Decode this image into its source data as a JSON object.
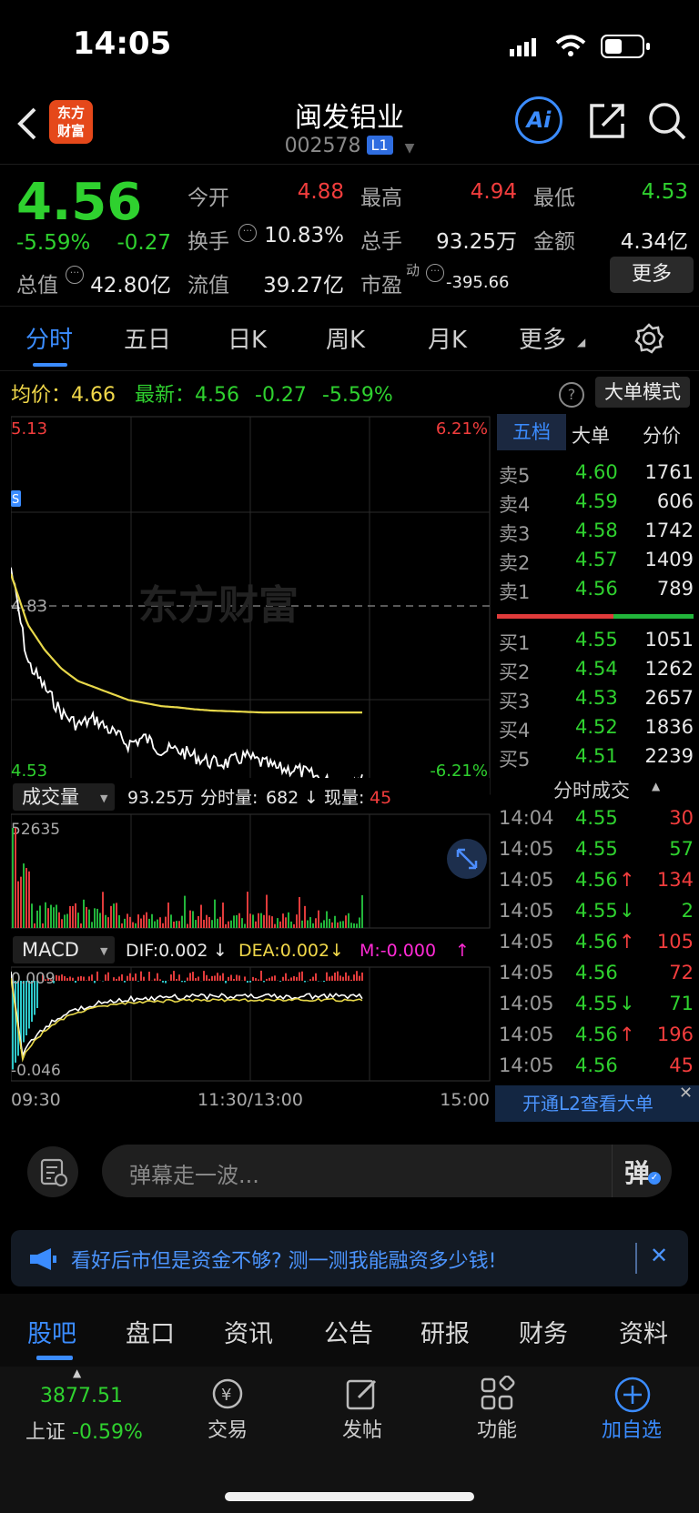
{
  "status_bar": {
    "time": "14:05"
  },
  "header": {
    "title": "闽发铝业",
    "code": "002578",
    "level_badge": "L1",
    "logo_line1": "东方",
    "logo_line2": "财富",
    "ai_label": "Ai"
  },
  "quote": {
    "price": "4.56",
    "change_pct": "-5.59%",
    "change": "-0.27",
    "open_label": "今开",
    "open": "4.88",
    "high_label": "最高",
    "high": "4.94",
    "low_label": "最低",
    "low": "4.53",
    "turnover_label": "换手",
    "turnover": "10.83%",
    "volume_label": "总手",
    "volume": "93.25万",
    "amount_label": "金额",
    "amount": "4.34亿",
    "total_cap_label": "总值",
    "total_cap": "42.80亿",
    "float_cap_label": "流值",
    "float_cap": "39.27亿",
    "pe_label": "市盈",
    "pe_sup": "动",
    "pe": "-395.66",
    "more_button": "更多"
  },
  "tabs": [
    "分时",
    "五日",
    "日K",
    "周K",
    "月K",
    "更多"
  ],
  "intraday": {
    "avg_label": "均价：",
    "avg": "4.66",
    "latest_label": "最新：",
    "latest": "4.56",
    "latest_change": "-0.27",
    "latest_pct": "-5.59%",
    "big_order_mode": "大单模式",
    "y_top": "5.13",
    "y_mid": "4.83",
    "y_bottom": "4.53",
    "pct_top": "6.21%",
    "pct_bottom": "-6.21%",
    "watermark": "东方财富",
    "volume_label": "成交量",
    "volume_total": "93.25万",
    "tick_vol_label": "分时量:",
    "tick_vol": "682",
    "cur_vol_label": "现量:",
    "cur_vol": "45",
    "vol_max": "52635",
    "macd_label": "MACD",
    "dif": "DIF:0.002",
    "dea": "DEA:0.002",
    "m": "M:-0.000",
    "macd_top": "0.009",
    "macd_bottom": "-0.046",
    "x_start": "09:30",
    "x_mid": "11:30/13:00",
    "x_end": "15:00",
    "s_badge": "S"
  },
  "chart_data": {
    "type": "line",
    "title": "",
    "xlabel": "",
    "ylabel": "",
    "ylim": [
      4.53,
      5.13
    ],
    "x_ticks": [
      "09:30",
      "11:30/13:00",
      "15:00"
    ],
    "prev_close": 4.83,
    "series": [
      {
        "name": "",
        "color": "#ffffff",
        "values": [
          4.89,
          4.74,
          4.7,
          4.66,
          4.64,
          4.65,
          4.63,
          4.61,
          4.62,
          4.6,
          4.6,
          4.59,
          4.58,
          4.58,
          4.59,
          4.58,
          4.57,
          4.57,
          4.56,
          4.55,
          4.55,
          4.56
        ]
      },
      {
        "name": "",
        "color": "#e8d84a",
        "values": [
          4.88,
          4.8,
          4.76,
          4.73,
          4.71,
          4.7,
          4.69,
          4.68,
          4.675,
          4.67,
          4.668,
          4.665,
          4.663,
          4.662,
          4.661,
          4.66,
          4.66,
          4.66,
          4.66,
          4.66,
          4.66,
          4.66
        ]
      }
    ]
  },
  "order_book": {
    "tabs": [
      "五档",
      "大单",
      "分价"
    ],
    "asks": [
      {
        "label": "卖5",
        "price": "4.60",
        "vol": "1761"
      },
      {
        "label": "卖4",
        "price": "4.59",
        "vol": "606"
      },
      {
        "label": "卖3",
        "price": "4.58",
        "vol": "1742"
      },
      {
        "label": "卖2",
        "price": "4.57",
        "vol": "1409"
      },
      {
        "label": "卖1",
        "price": "4.56",
        "vol": "789"
      }
    ],
    "bids": [
      {
        "label": "买1",
        "price": "4.55",
        "vol": "1051"
      },
      {
        "label": "买2",
        "price": "4.54",
        "vol": "1262"
      },
      {
        "label": "买3",
        "price": "4.53",
        "vol": "2657"
      },
      {
        "label": "买4",
        "price": "4.52",
        "vol": "1836"
      },
      {
        "label": "买5",
        "price": "4.51",
        "vol": "2239"
      }
    ],
    "ticks_title": "分时成交",
    "ticks": [
      {
        "time": "14:04",
        "price": "4.55",
        "arrow": "",
        "vol": "30"
      },
      {
        "time": "14:05",
        "price": "4.55",
        "arrow": "",
        "vol": "57"
      },
      {
        "time": "14:05",
        "price": "4.56",
        "arrow": "↑",
        "vol": "134"
      },
      {
        "time": "14:05",
        "price": "4.55",
        "arrow": "↓",
        "vol": "2"
      },
      {
        "time": "14:05",
        "price": "4.56",
        "arrow": "↑",
        "vol": "105"
      },
      {
        "time": "14:05",
        "price": "4.56",
        "arrow": "",
        "vol": "72"
      },
      {
        "time": "14:05",
        "price": "4.55",
        "arrow": "↓",
        "vol": "71"
      },
      {
        "time": "14:05",
        "price": "4.56",
        "arrow": "↑",
        "vol": "196"
      },
      {
        "time": "14:05",
        "price": "4.56",
        "arrow": "",
        "vol": "45"
      }
    ],
    "l2_banner": "开通L2查看大单"
  },
  "danmu": {
    "placeholder": "弹幕走一波...",
    "send": "弹"
  },
  "ad": {
    "text": "看好后市但是资金不够? 测一测我能融资多少钱!"
  },
  "bottom_tabs": [
    "股吧",
    "盘口",
    "资讯",
    "公告",
    "研报",
    "财务",
    "资料"
  ],
  "dock": {
    "index_value": "3877.51",
    "index_name": "上证",
    "index_pct": "-0.59%",
    "trade": "交易",
    "post": "发帖",
    "func": "功能",
    "add": "加自选"
  }
}
